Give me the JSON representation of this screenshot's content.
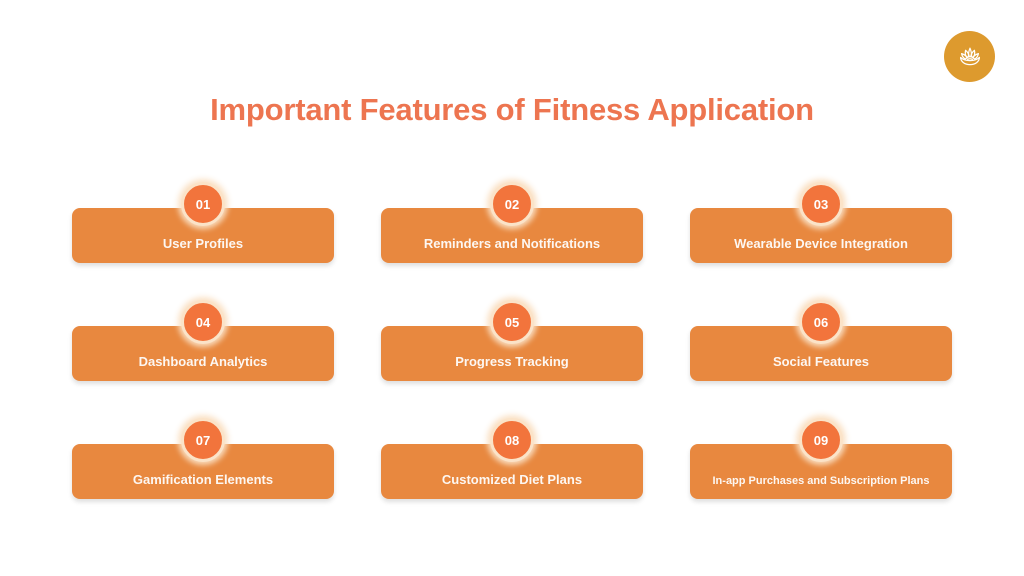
{
  "page": {
    "background_color": "#ffffff",
    "title": "Important Features of Fitness Application",
    "title_color": "#ED7550"
  },
  "logo": {
    "icon": "lotus-icon",
    "background_color": "#DD9A2E",
    "mark_color": "#FFFFFF"
  },
  "theme": {
    "card_color": "#E8883F",
    "badge_color": "#F2743C",
    "badge_ring_color": "#FBE3C8",
    "card_text_color": "#FDF7F2"
  },
  "features": [
    {
      "number": "01",
      "label": "User Profiles",
      "small": false
    },
    {
      "number": "02",
      "label": "Reminders and Notifications",
      "small": false
    },
    {
      "number": "03",
      "label": "Wearable Device Integration",
      "small": false
    },
    {
      "number": "04",
      "label": "Dashboard Analytics",
      "small": false
    },
    {
      "number": "05",
      "label": "Progress Tracking",
      "small": false
    },
    {
      "number": "06",
      "label": "Social Features",
      "small": false
    },
    {
      "number": "07",
      "label": "Gamification Elements",
      "small": false
    },
    {
      "number": "08",
      "label": "Customized Diet Plans",
      "small": false
    },
    {
      "number": "09",
      "label": "In-app Purchases and Subscription Plans",
      "small": true
    }
  ]
}
